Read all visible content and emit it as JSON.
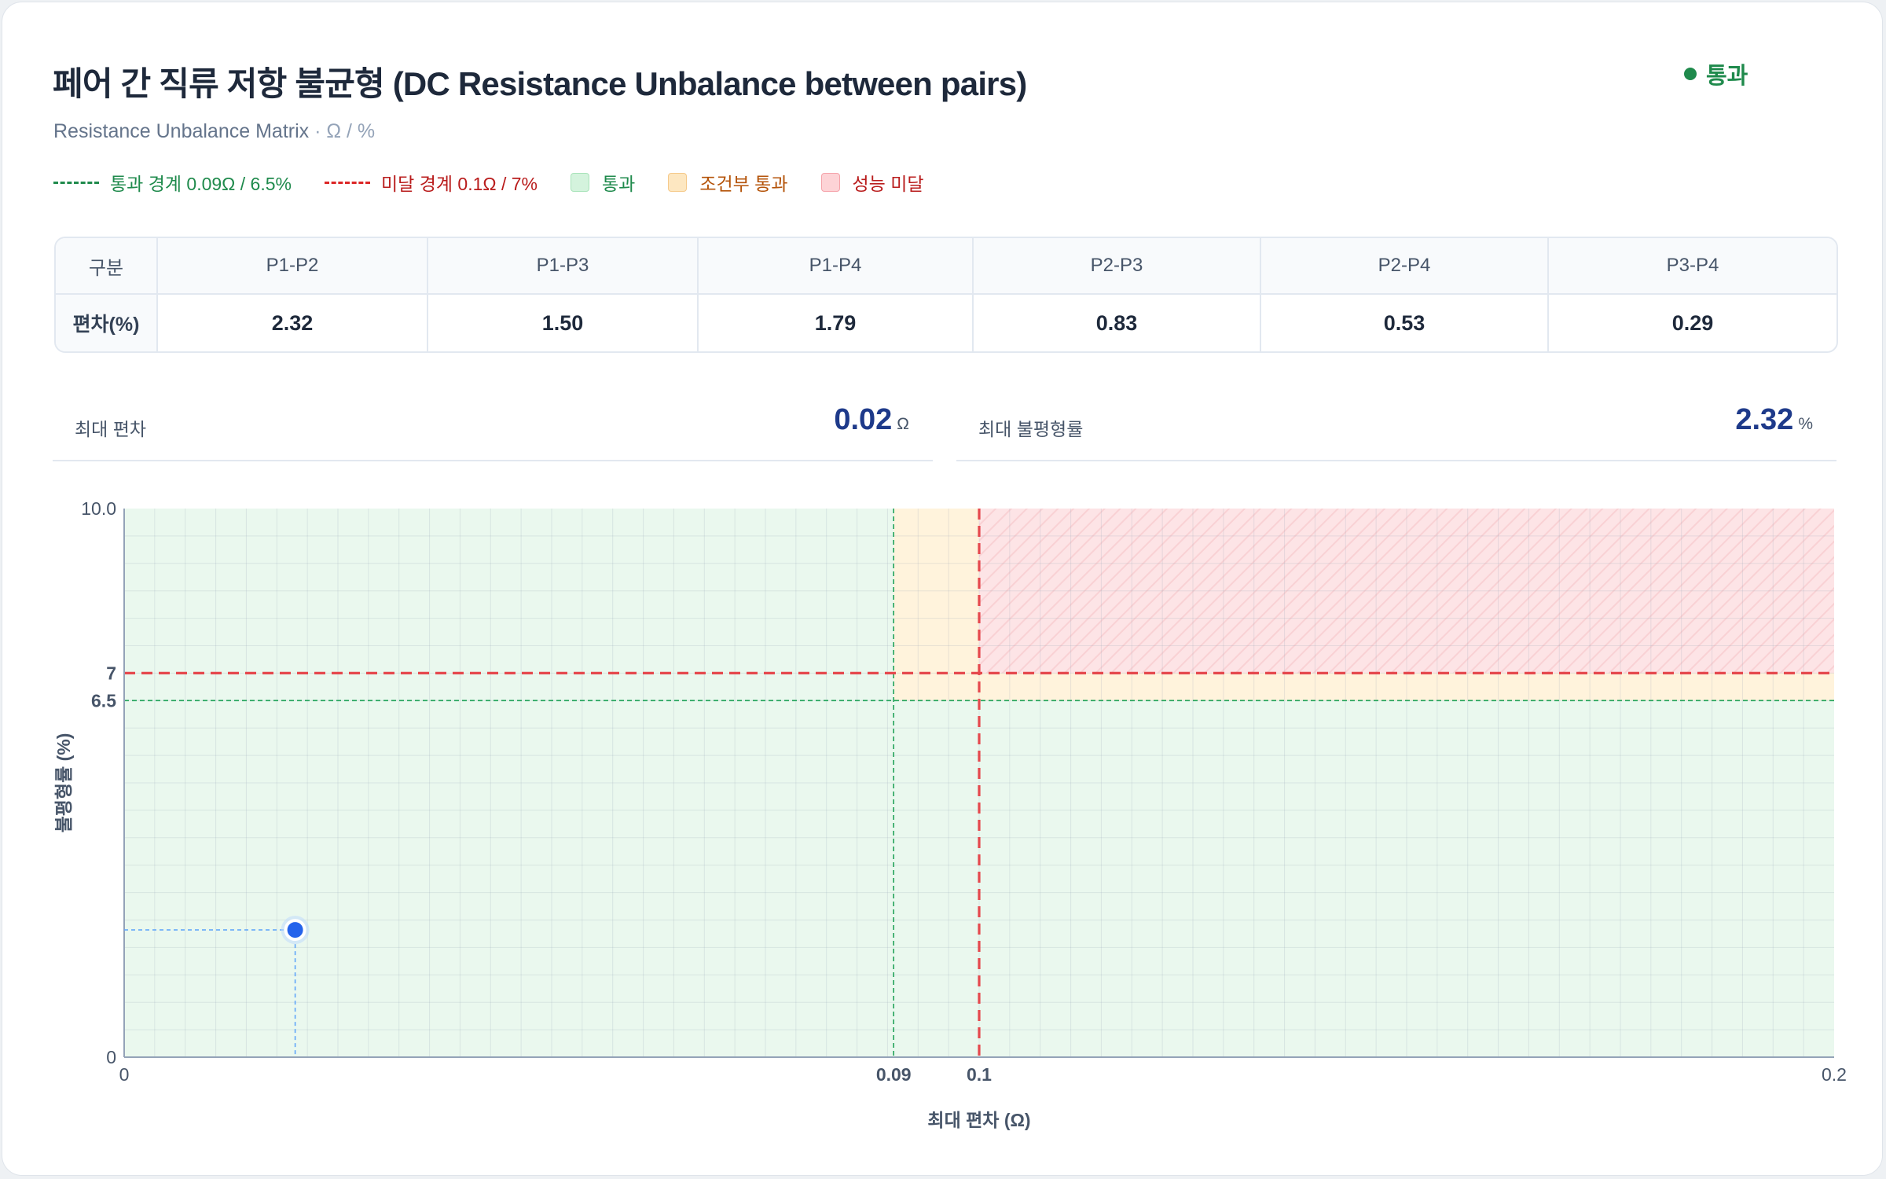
{
  "header": {
    "title": "페어 간 직류 저항 불균형 (DC Resistance Unbalance between pairs)",
    "subtitle": "Resistance Unbalance Matrix",
    "subtitle_units": "· Ω / %",
    "status_label": "통과",
    "status_color": "#1f8a4c"
  },
  "legend": {
    "pass_limit": "통과 경계 0.09Ω / 6.5%",
    "fail_limit": "미달 경계 0.1Ω / 7%",
    "pass_zone": "통과",
    "conditional_zone": "조건부 통과",
    "fail_zone": "성능 미달"
  },
  "table": {
    "row_header": "구분",
    "row_label": "편차(%)",
    "columns": [
      {
        "pair": "P1-P2",
        "value": "2.32"
      },
      {
        "pair": "P1-P3",
        "value": "1.50"
      },
      {
        "pair": "P1-P4",
        "value": "1.79"
      },
      {
        "pair": "P2-P3",
        "value": "0.83"
      },
      {
        "pair": "P2-P4",
        "value": "0.53"
      },
      {
        "pair": "P3-P4",
        "value": "0.29"
      }
    ]
  },
  "kpis": {
    "max_deviation": {
      "label": "최대 편차",
      "value": "0.02",
      "unit": "Ω"
    },
    "max_unbalance": {
      "label": "최대 불평형률",
      "value": "2.32",
      "unit": "%"
    }
  },
  "colors": {
    "pass_zone": "#eaf8ee",
    "conditional_zone": "#fff3dc",
    "fail_zone": "#fde4e6",
    "pass_line": "#22a35a",
    "fail_line": "#e5484d",
    "point": "#2563eb",
    "accent_value": "#1e3a8a"
  },
  "chart_data": {
    "type": "scatter",
    "xlabel": "최대 편차 (Ω)",
    "ylabel": "불평형률 (%)",
    "xlim": [
      0,
      0.2
    ],
    "ylim": [
      0,
      10
    ],
    "x_ticks": [
      "0",
      "0.2"
    ],
    "y_ticks": [
      "0",
      "10.0"
    ],
    "thresholds": {
      "pass": {
        "x": 0.09,
        "y": 6.5,
        "x_label": "0.09",
        "y_label": "6.5"
      },
      "fail": {
        "x": 0.1,
        "y": 7,
        "x_label": "0.1",
        "y_label": "7"
      }
    },
    "points": [
      {
        "x": 0.02,
        "y": 2.32
      }
    ],
    "grid": true
  }
}
